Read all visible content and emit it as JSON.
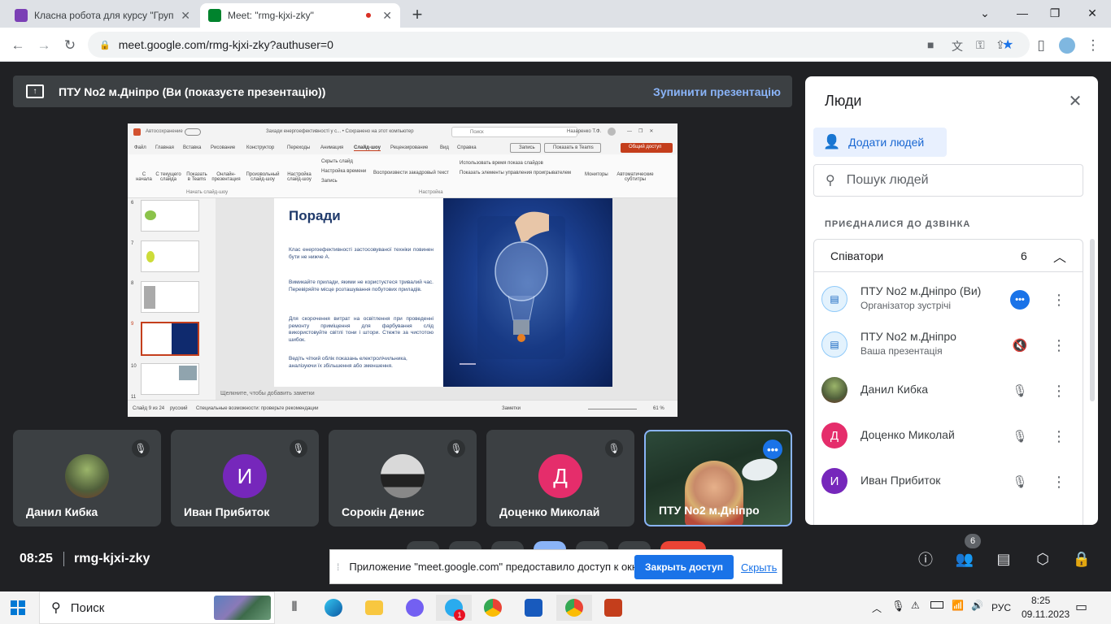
{
  "browser": {
    "tabs": [
      {
        "title": "Класна робота для курсу \"Груп",
        "favicon_color": "#7b3fb5"
      },
      {
        "title": "Meet: \"rmg-kjxi-zky\"",
        "favicon_color": "#00832d",
        "recording": "⏺"
      }
    ],
    "new_tab": "+",
    "url": "meet.google.com/rmg-kjxi-zky?authuser=0"
  },
  "banner": {
    "text": "ПТУ No2 м.Дніпро (Ви (показуєте презентацію))",
    "stop_button": "Зупинити презентацію"
  },
  "presentation": {
    "title": "Поради",
    "paragraphs": [
      "Клас енергоефективності застосовуваної техніки повинен бути не нижче А.",
      "Вимикайте прилади, якими не користуєтеся тривалий час. Перевіряйте місце розташування побутових приладів.",
      "Для скорочення витрат на освітлення при проведенні ремонту приміщення для фарбування слід використовуйте світлі тони і штори. Стежте за чистотою шибок.",
      "Ведіть чіткий облік показань електролічильника, аналізуючи їх збільшення або зменшення."
    ],
    "notes_placeholder": "Щелкните, чтобы добавить заметки",
    "ribbon_tabs": [
      "Файл",
      "Главная",
      "Вставка",
      "Рисование",
      "Конструктор",
      "Переходы",
      "Анимация",
      "Слайд-шоу",
      "Рецензирование",
      "Вид",
      "Справка"
    ],
    "ribbon_active_tab": "Слайд-шоу",
    "ribbon_buttons": [
      "С начала",
      "С текущего слайда",
      "Показать в Teams",
      "Онлайн-презентация",
      "Произвольный слайд-шоу",
      "Настройка слайд-шоу",
      "Скрыть слайд",
      "Настройка времени",
      "Запись",
      "Мониторы",
      "Автоматические субтитры"
    ],
    "ribbon_checks": [
      "Воспроизвести закадровый текст",
      "Использовать время показа слайдов",
      "Показать элементы управления проигрывателем"
    ],
    "ribbon_group_labels": [
      "Начать слайд-шоу",
      "Настройка"
    ],
    "window_title": "Захади енергоефективності у с... • Сохранено на этот компьютер",
    "autosave": "Автосохранение",
    "search": "Поиск",
    "user": "Назаренко Т.Ф.",
    "share_buttons": [
      "Запись",
      "Показать в Teams",
      "Общий доступ"
    ],
    "slide_numbers": [
      "6",
      "7",
      "8",
      "9",
      "10",
      "11"
    ],
    "status": {
      "slide": "Слайд 9 из 24",
      "lang": "русский",
      "accessibility": "Специальные возможности: проверьте рекомендации",
      "notes": "Заметки",
      "zoom": "61 %"
    }
  },
  "tiles": [
    {
      "name": "Данил Кибка"
    },
    {
      "name": "Иван Прибиток",
      "initial": "И",
      "color": "#7627bb"
    },
    {
      "name": "Сорокін Денис"
    },
    {
      "name": "Доценко Миколай",
      "initial": "Д",
      "color": "#e52d6b"
    },
    {
      "name": "ПТУ No2 м.Дніпро"
    }
  ],
  "people_panel": {
    "title": "Люди",
    "add_people": "Додати людей",
    "search_placeholder": "Пошук людей",
    "section_label": "ПРИЄДНАЛИСЯ ДО ДЗВІНКА",
    "group": {
      "name": "Співатори",
      "count": "6"
    },
    "participants": [
      {
        "name": "ПТУ No2 м.Дніпро (Ви)",
        "subtitle": "Організатор зустрічі"
      },
      {
        "name": "ПТУ No2 м.Дніпро",
        "subtitle": "Ваша презентація"
      },
      {
        "name": "Данил Кибка"
      },
      {
        "name": "Доценко Миколай",
        "initial": "Д",
        "color": "#e52d6b"
      },
      {
        "name": "Иван Прибиток",
        "initial": "И",
        "color": "#7627bb"
      }
    ]
  },
  "bottom_bar": {
    "time": "08:25",
    "meeting_code": "rmg-kjxi-zky",
    "participant_count": "6"
  },
  "share_notice": {
    "text": "Приложение \"meet.google.com\" предоставило доступ к окну.",
    "stop_button": "Закрыть доступ",
    "hide_link": "Скрыть"
  },
  "taskbar": {
    "search": "Поиск",
    "lang": "РУС",
    "time": "8:25",
    "date": "09.11.2023",
    "telegram_badge": "1"
  }
}
